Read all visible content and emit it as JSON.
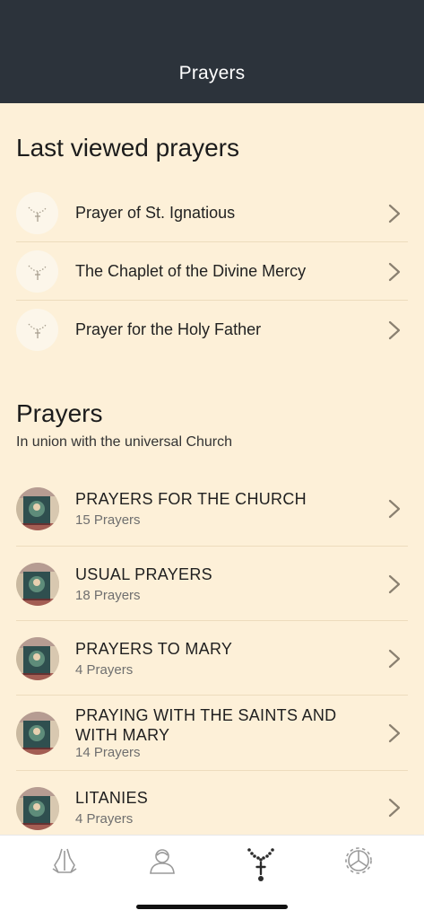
{
  "header": {
    "title": "Prayers"
  },
  "last_viewed": {
    "title": "Last viewed prayers",
    "items": [
      {
        "label": "Prayer of St. Ignatious",
        "icon": "rosary-icon"
      },
      {
        "label": "The Chaplet of the Divine Mercy",
        "icon": "rosary-icon"
      },
      {
        "label": "Prayer for the Holy Father",
        "icon": "rosary-icon"
      }
    ]
  },
  "prayers": {
    "title": "Prayers",
    "subtitle": "In union with the universal Church",
    "categories": [
      {
        "title": "PRAYERS FOR THE CHURCH",
        "count": "15 Prayers"
      },
      {
        "title": "USUAL PRAYERS",
        "count": "18 Prayers"
      },
      {
        "title": "PRAYERS TO MARY",
        "count": "4 Prayers"
      },
      {
        "title": "PRAYING WITH THE SAINTS AND WITH MARY",
        "count": "14 Prayers"
      },
      {
        "title": "LITANIES",
        "count": "4 Prayers"
      }
    ]
  },
  "tabbar": {
    "tabs": [
      {
        "icon": "praying-hands-icon"
      },
      {
        "icon": "person-profile-icon"
      },
      {
        "icon": "rosary-icon",
        "selected": true
      },
      {
        "icon": "settings-gear-icon"
      }
    ]
  },
  "colors": {
    "header_bg": "#2c333b",
    "page_bg": "#fdf0d8",
    "tabbar_bg": "#ffffff"
  }
}
